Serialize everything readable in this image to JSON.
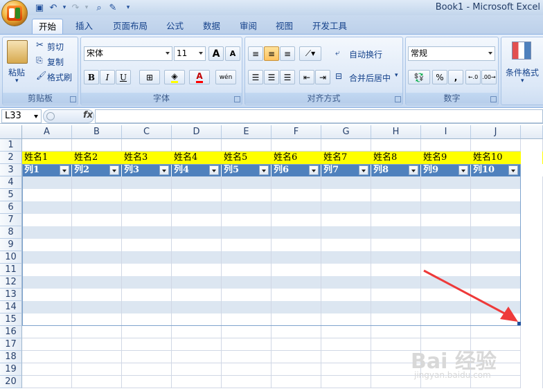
{
  "window": {
    "title": "Book1 - Microsoft Excel"
  },
  "tabs": [
    "开始",
    "插入",
    "页面布局",
    "公式",
    "数据",
    "审阅",
    "视图",
    "开发工具"
  ],
  "active_tab": "开始",
  "clipboard": {
    "paste": "粘贴",
    "cut": "剪切",
    "copy": "复制",
    "format_painter": "格式刷",
    "label": "剪贴板"
  },
  "font": {
    "name": "宋体",
    "size": "11",
    "bold": "B",
    "italic": "I",
    "underline": "U",
    "label": "字体",
    "grow": "A",
    "shrink": "A",
    "color_letter": "A",
    "phonetic": "wén"
  },
  "alignment": {
    "wrap": "自动换行",
    "merge": "合并后居中",
    "label": "对齐方式"
  },
  "number": {
    "format": "常规",
    "percent": "%",
    "comma": ",",
    "label": "数字"
  },
  "styles": {
    "conditional": "条件格式"
  },
  "formula_bar": {
    "name_box": "L33",
    "fx": "fx",
    "value": ""
  },
  "columns": [
    "A",
    "B",
    "C",
    "D",
    "E",
    "F",
    "G",
    "H",
    "I",
    "J"
  ],
  "rows": [
    "1",
    "2",
    "3",
    "4",
    "5",
    "6",
    "7",
    "8",
    "9",
    "10",
    "11",
    "12",
    "13",
    "14",
    "15",
    "16",
    "17",
    "18",
    "19",
    "20"
  ],
  "row2_names": [
    "姓名1",
    "姓名2",
    "姓名3",
    "姓名4",
    "姓名5",
    "姓名6",
    "姓名7",
    "姓名8",
    "姓名9",
    "姓名10"
  ],
  "row3_headers": [
    "列1",
    "列2",
    "列3",
    "列4",
    "列5",
    "列6",
    "列7",
    "列8",
    "列9",
    "列10"
  ],
  "watermark": {
    "brand": "Bai 经验",
    "url": "jingyan.baidu.com"
  }
}
